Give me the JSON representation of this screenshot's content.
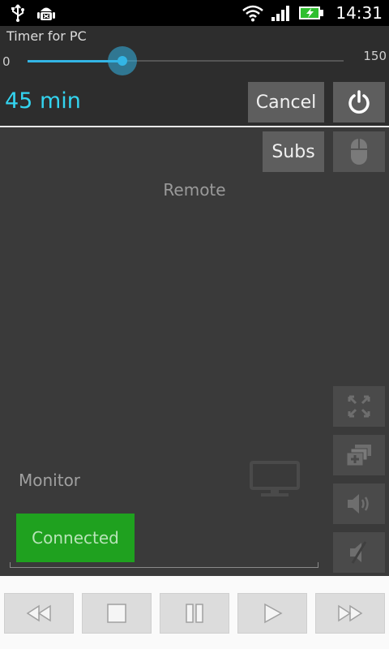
{
  "status_bar": {
    "time": "14:31",
    "icons": [
      "usb-icon",
      "android-debug-icon",
      "wifi-icon",
      "signal-icon",
      "battery-charging-icon"
    ]
  },
  "timer": {
    "title": "Timer for PC",
    "min": "0",
    "max": "150",
    "value": 45,
    "value_label": "45 min",
    "cancel_label": "Cancel",
    "accent": "#33b5e5",
    "value_color": "#33d4f0"
  },
  "remote": {
    "subs_label": "Subs",
    "title": "Remote"
  },
  "monitor": {
    "label": "Monitor",
    "status": "Connected",
    "status_color": "#1fa11f"
  },
  "side_buttons": [
    "fullscreen-icon",
    "new-window-icon",
    "volume-icon",
    "mute-icon"
  ],
  "media_buttons": [
    "rewind-icon",
    "stop-icon",
    "pause-icon",
    "play-icon",
    "fast-forward-icon"
  ]
}
